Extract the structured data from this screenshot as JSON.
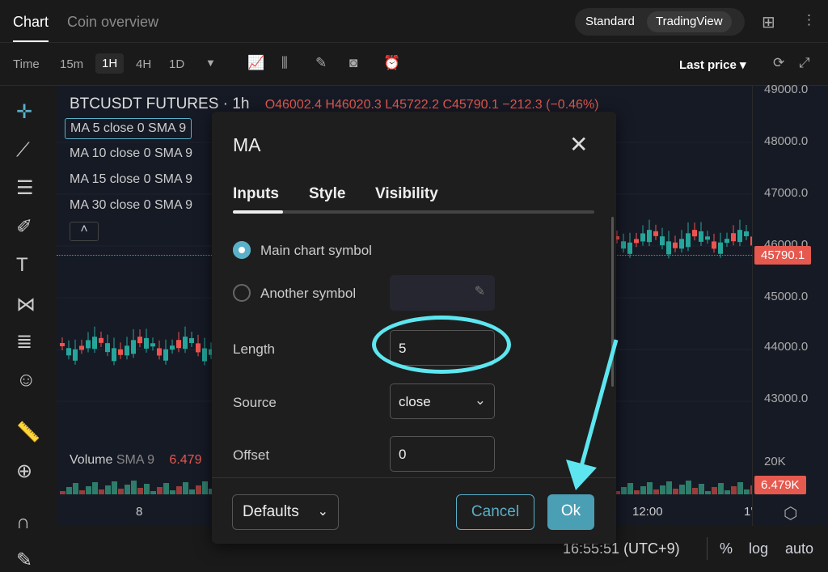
{
  "top": {
    "tabs": [
      "Chart",
      "Coin overview"
    ],
    "modes": [
      "Standard",
      "TradingView"
    ]
  },
  "toolbar": {
    "time_label": "Time",
    "intervals": [
      "15m",
      "1H",
      "4H",
      "1D"
    ],
    "price_mode": "Last price"
  },
  "chart": {
    "symbol": "BTCUSDT FUTURES · 1h",
    "ohlc": {
      "o": "O46002.4",
      "h": "H46020.3",
      "l": "L45722.2",
      "c": "C45790.1",
      "chg": "−212.3 (−0.46%)"
    },
    "ma_rows": [
      "MA 5 close 0 SMA 9",
      "MA 10 close 0 SMA 9",
      "MA 15 close 0 SMA 9",
      "MA 30 close 0 SMA 9"
    ],
    "price_ticks": [
      "49000.0",
      "48000.0",
      "47000.0",
      "46000.0",
      "45000.0",
      "44000.0",
      "43000.0"
    ],
    "last_price": "45790.1",
    "volume_label": "Volume",
    "volume_sma": "SMA 9",
    "volume_value": "6.479",
    "volume_tick": "20K",
    "volume_badge": "6.479K",
    "time_ticks": [
      "8",
      "12:00",
      "1'"
    ],
    "colors": {
      "up": "#26a69a",
      "down": "#ef5350",
      "accent": "#5ab0c8"
    }
  },
  "status": {
    "clock": "16:55:51 (UTC+9)",
    "percent": "%",
    "log": "log",
    "auto": "auto"
  },
  "modal": {
    "title": "MA",
    "tabs": [
      "Inputs",
      "Style",
      "Visibility"
    ],
    "main_symbol": "Main chart symbol",
    "another_symbol": "Another symbol",
    "length_label": "Length",
    "length_value": "5",
    "source_label": "Source",
    "source_value": "close",
    "offset_label": "Offset",
    "offset_value": "0",
    "defaults": "Defaults",
    "cancel": "Cancel",
    "ok": "Ok"
  }
}
